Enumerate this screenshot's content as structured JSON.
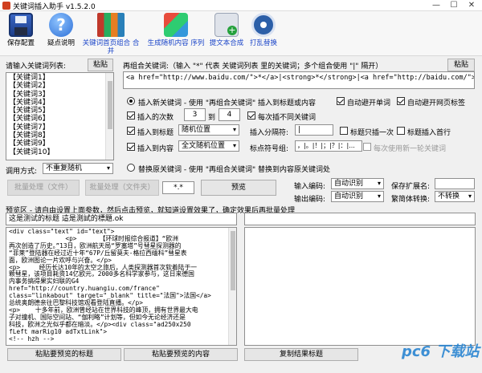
{
  "window": {
    "title": "关键词插入助手 v1.5.2.0",
    "minimize": "—",
    "maximize": "☐",
    "close": "✕"
  },
  "toolbar": [
    {
      "label": "保存配置",
      "icon": "save-icon"
    },
    {
      "label": "疑点说明",
      "icon": "help-icon"
    },
    {
      "label": "关键词首页组合 合并",
      "icon": "books-icon"
    },
    {
      "label": "生成随机内容 序列",
      "icon": "blocks-icon"
    },
    {
      "label": "提文本合成",
      "icon": "merge-icon"
    },
    {
      "label": "打乱替换",
      "icon": "shuffle-icon"
    }
  ],
  "left": {
    "label": "请输入关键词列表:",
    "paste": "粘贴",
    "keywords": [
      "【关键词1】",
      "【关键词2】",
      "【关键词3】",
      "【关键词4】",
      "【关键词5】",
      "【关键词6】",
      "【关键词7】",
      "【关键词8】",
      "【关键词9】",
      "【关键词10】"
    ],
    "mode_label": "调用方式:",
    "mode_value": "不重复随机"
  },
  "combo": {
    "label": "再组合关键词:（输入 \"*\" 代表 关键词列表 里的关键词；多个组合使用 \"|\" 隔开）",
    "paste": "粘贴",
    "value": "<a href=\"http://www.baidu.com/\">*</a>|<strong>*</strong>|<a href=\"http://baidu.com/\">*</a>"
  },
  "insert": {
    "mode_label": "插入新关键词 - 使用 \"再组合关键词\" 插入到标题或内容",
    "auto_avoid_word": "自动避开单词",
    "auto_avoid_tag": "自动避开网页标签",
    "times_label": "插入的次数",
    "times_from": "3",
    "to": "到",
    "times_to": "4",
    "no_repeat": "每次插不同关键词",
    "title_label": "插入到标题",
    "title_pos": "随机位置",
    "sep_label": "插入分隔符:",
    "sep_value": "|",
    "title_once": "标题只插一次",
    "title_first": "标题插入首行",
    "content_label": "插入到内容",
    "content_pos": "全文随机位置",
    "punct_label": "标点符号组:",
    "punct_value": "，|。|！|；|？|：|...",
    "new_round": "每次使用新一轮关键词"
  },
  "replace": {
    "label": "替换原关键词 - 使用 \"再组合关键词\" 替换到内容原关键词处"
  },
  "actions": {
    "batch_file": "批量处理（文件）",
    "batch_folder": "批量处理（文件夹）",
    "ext": "*.*",
    "preview": "预览"
  },
  "encoding": {
    "in_label": "输入编码:",
    "in_value": "自动识别",
    "out_label": "输出编码:",
    "out_value": "自动识别",
    "save_ext_label": "保存扩展名:",
    "save_ext_value": "",
    "conv_label": "繁简体转换:",
    "conv_value": "不转换"
  },
  "preview": {
    "hint": "预览区 - 请自由设置上面参数，然后点击预览，就知道设置效果了，确定效果后再批量处理",
    "title_line": "这是测试的标题 這是測試的標題.ok",
    "content_lines": [
      "<div class=\"text\" id=\"text\">",
      "               <p>      【环球时报综合报道】“欧洲",
      "再次创造了历史。”13日，欧洲航天局“罗塞塔”号彗星探测器的",
      "“菲莱”登陆器在经过近十年“67P/丘留莫夫-格拉西缅科”彗星表",
      "面，欧洲图论一片欢呼与兴奋。</p>",
      "<p>     经历长达10年的太空之旅后，人类探测器首次软着陆于一",
      "颗彗星，该项目耗资14亿欧元，2000多名科学家参与，这日来德国",
      "内事务搞得果实妇联的G4",
      "href=\"http://country.huangiu.com/france\"",
      "class=\"linkabout\" target=\"_blank\" title=\"法国\">法国</a>",
      "总统奥朗德亲往巴黎科技馆观看登陆直播。</p>",
      "<p>    十多年前，欧洲曾经站在世界科技的峰顶，拥有世界最大电",
      "子对撞机、国际空间站、“伽利略”计划等，但如今无论经济还是",
      "科技，欧洲之光似乎都在暗淡。</p><div class=\"ad250x250",
      "fLeft marRig10 adTxtLink\">",
      "<!-- hzh -->"
    ],
    "paste_title": "粘贴要预览的标题",
    "paste_content": "粘贴要预览的内容",
    "copy_result": "复制结果标题"
  },
  "watermark": "pc6 下载站"
}
